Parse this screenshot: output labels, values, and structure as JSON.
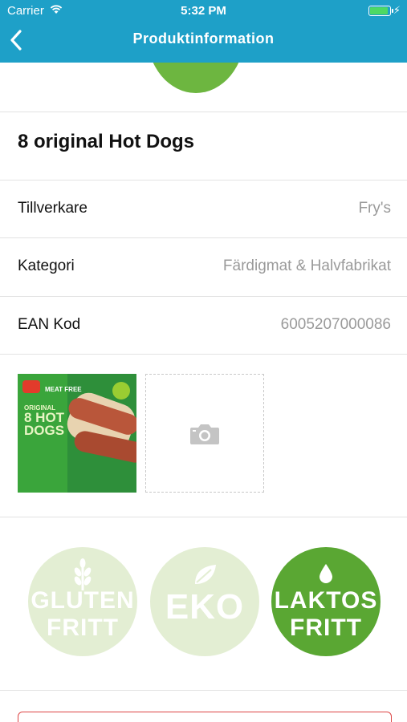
{
  "status_bar": {
    "carrier": "Carrier",
    "time": "5:32 PM"
  },
  "nav": {
    "title": "Produktinformation"
  },
  "product": {
    "name": "8 original Hot Dogs",
    "rows": [
      {
        "label": "Tillverkare",
        "value": "Fry's"
      },
      {
        "label": "Kategori",
        "value": "Färdigmat & Halvfabrikat"
      },
      {
        "label": "EAN Kod",
        "value": "6005207000086"
      }
    ]
  },
  "photo": {
    "brand": "FRY'S",
    "meatfree": "MEAT FREE",
    "original": "ORIGINAL",
    "line1": "8 HOT",
    "line2": "DOGS"
  },
  "badges": [
    {
      "line1": "GLUTEN",
      "line2": "FRITT",
      "icon": "wheat-icon",
      "active": false
    },
    {
      "line1": "EKO",
      "line2": "",
      "icon": "leaf-icon",
      "active": false
    },
    {
      "line1": "LAKTOS",
      "line2": "FRITT",
      "icon": "drop-icon",
      "active": true
    }
  ],
  "colors": {
    "header": "#1ea0c8",
    "badge_inactive": "#e3eed3",
    "badge_active": "#5aa733",
    "value_text": "#9a9a9a"
  }
}
